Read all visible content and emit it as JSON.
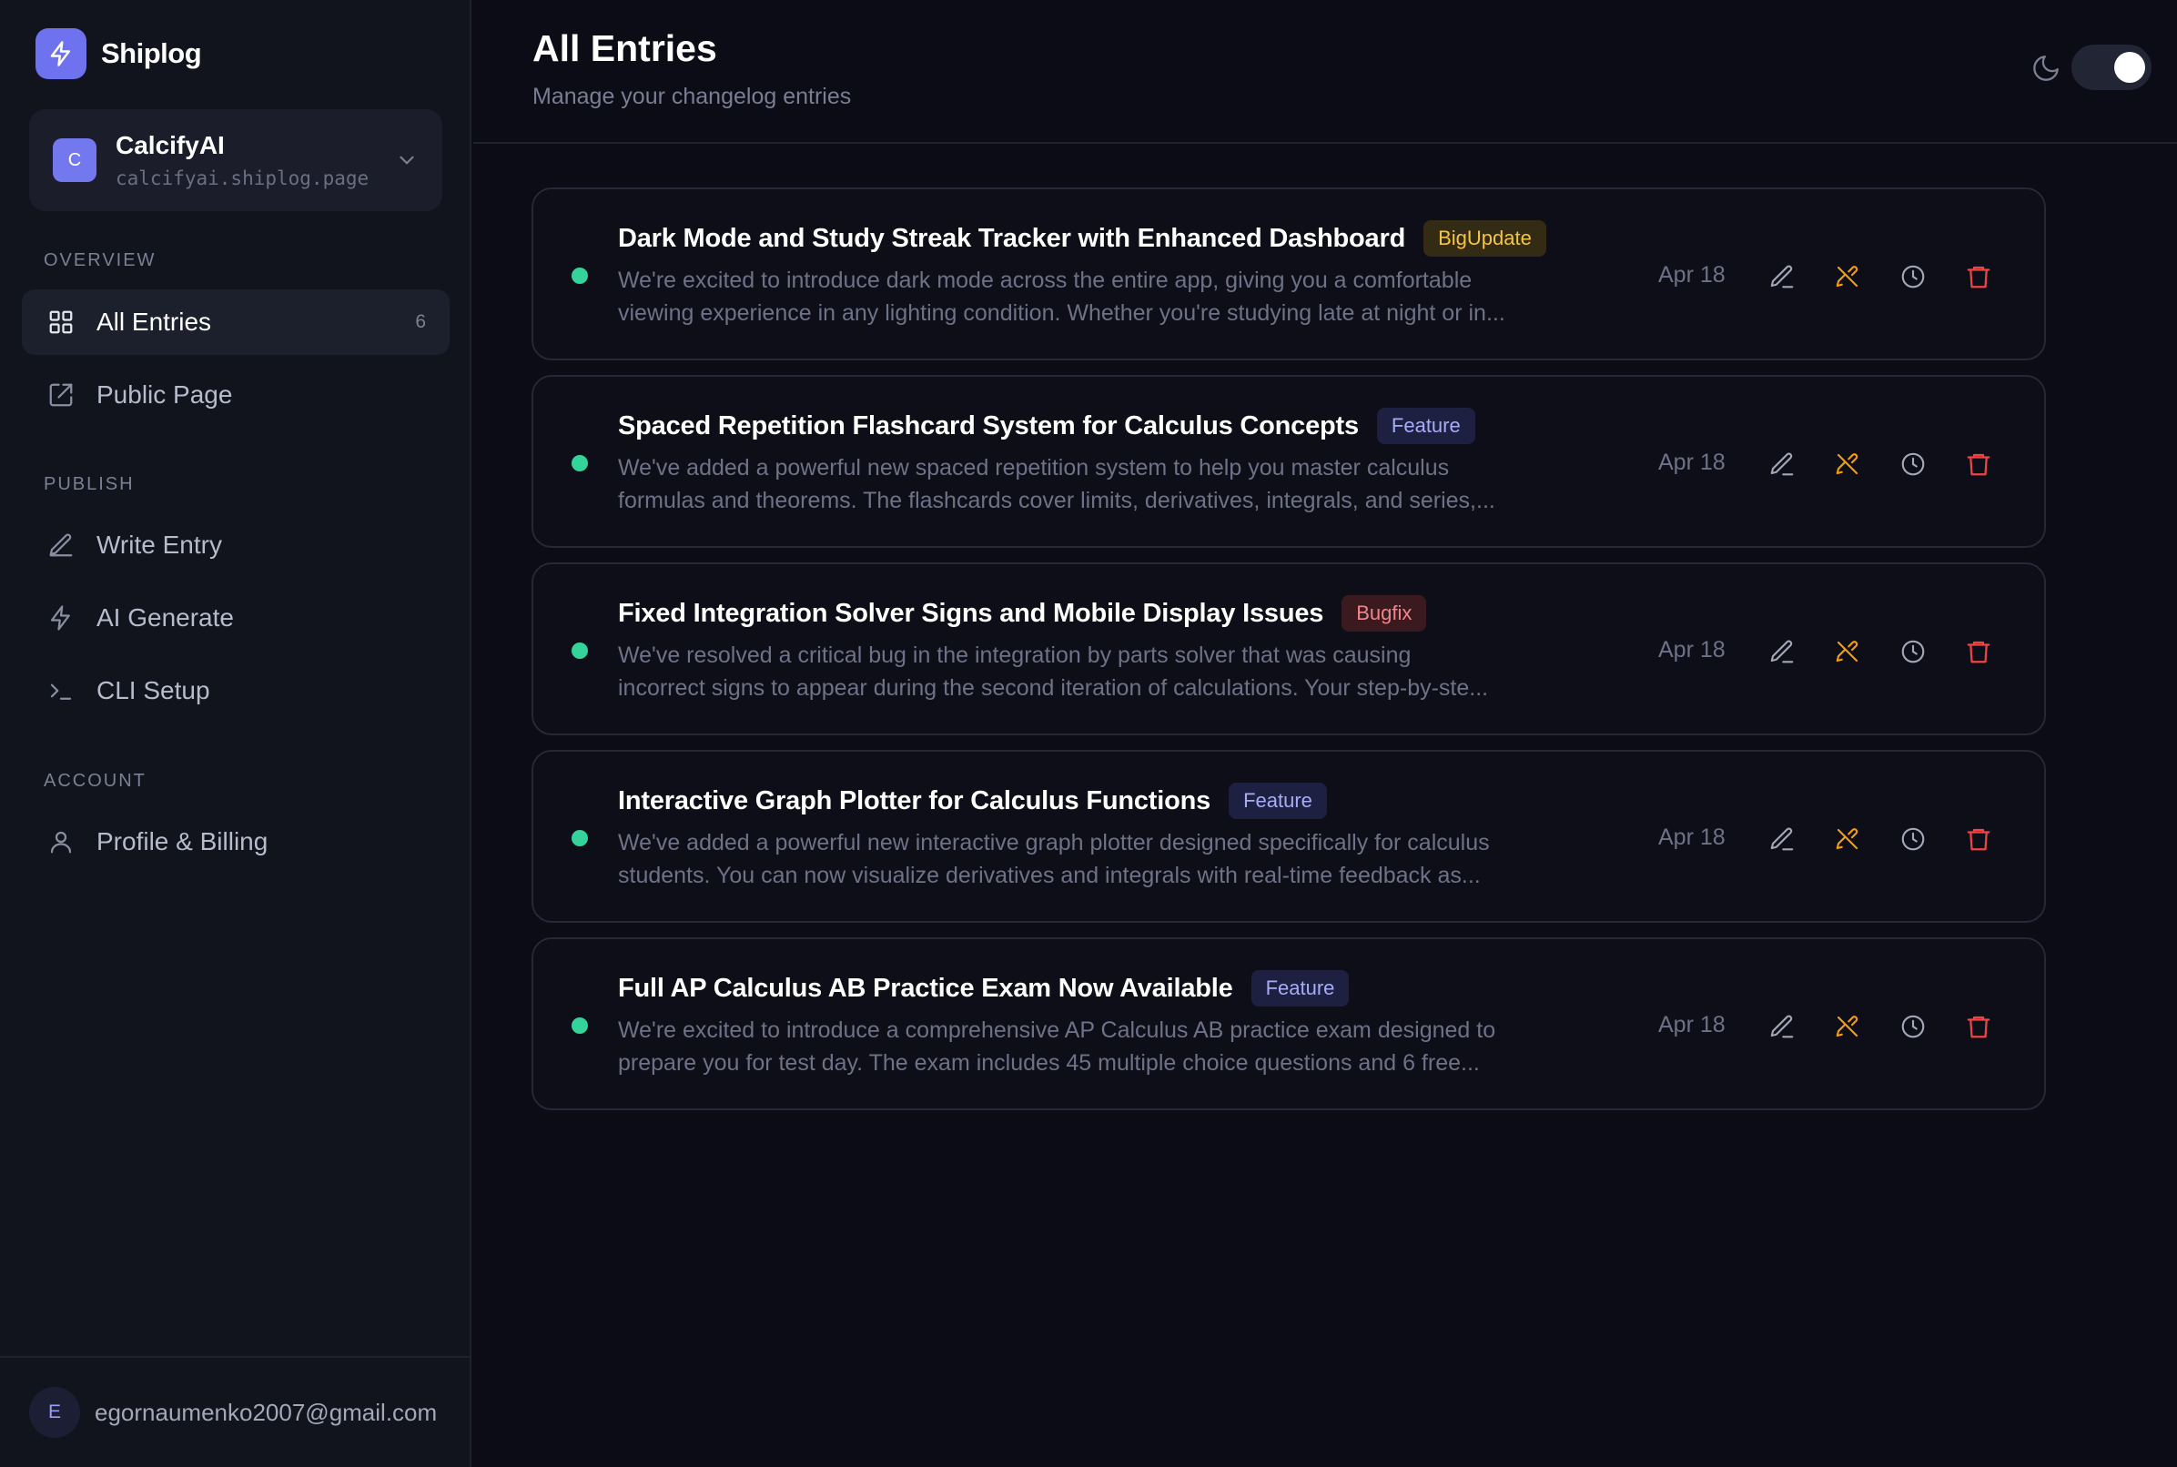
{
  "app": {
    "name": "Shiplog",
    "accent": "#6e72ee"
  },
  "project": {
    "initial": "C",
    "name": "CalcifyAI",
    "url": "calcifyai.shiplog.page"
  },
  "sidebar": {
    "sections": [
      {
        "label": "OVERVIEW",
        "items": [
          {
            "label": "All Entries",
            "icon": "grid-icon",
            "count": "6",
            "active": true
          },
          {
            "label": "Public Page",
            "icon": "external-link-icon",
            "count": "",
            "active": false
          }
        ]
      },
      {
        "label": "PUBLISH",
        "items": [
          {
            "label": "Write Entry",
            "icon": "pencil-icon",
            "count": "",
            "active": false
          },
          {
            "label": "AI Generate",
            "icon": "lightning-icon",
            "count": "",
            "active": false
          },
          {
            "label": "CLI Setup",
            "icon": "terminal-icon",
            "count": "",
            "active": false
          }
        ]
      },
      {
        "label": "ACCOUNT",
        "items": [
          {
            "label": "Profile & Billing",
            "icon": "user-icon",
            "count": "",
            "active": false
          }
        ]
      }
    ]
  },
  "user": {
    "initial": "E",
    "email": "egornaumenko2007@gmail.com"
  },
  "header": {
    "title": "All Entries",
    "subtitle": "Manage your changelog entries",
    "theme": "dark"
  },
  "entries": [
    {
      "title": "Dark Mode and Study Streak Tracker with Enhanced Dashboard",
      "badge": "BigUpdate",
      "badge_type": "bigupdate",
      "desc_line1": "We're excited to introduce dark mode across the entire app, giving you a comfortable",
      "desc_line2": "viewing experience in any lighting condition. Whether you're studying late at night or in...",
      "date": "Apr 18",
      "status": "published"
    },
    {
      "title": "Spaced Repetition Flashcard System for Calculus Concepts",
      "badge": "Feature",
      "badge_type": "feature",
      "desc_line1": "We've added a powerful new spaced repetition system to help you master calculus",
      "desc_line2": "formulas and theorems. The flashcards cover limits, derivatives, integrals, and series,...",
      "date": "Apr 18",
      "status": "published"
    },
    {
      "title": "Fixed Integration Solver Signs and Mobile Display Issues",
      "badge": "Bugfix",
      "badge_type": "bugfix",
      "desc_line1": "We've resolved a critical bug in the integration by parts solver that was causing",
      "desc_line2": "incorrect signs to appear during the second iteration of calculations. Your step-by-ste...",
      "date": "Apr 18",
      "status": "published"
    },
    {
      "title": "Interactive Graph Plotter for Calculus Functions",
      "badge": "Feature",
      "badge_type": "feature",
      "desc_line1": "We've added a powerful new interactive graph plotter designed specifically for calculus",
      "desc_line2": "students. You can now visualize derivatives and integrals with real-time feedback as...",
      "date": "Apr 18",
      "status": "published"
    },
    {
      "title": "Full AP Calculus AB Practice Exam Now Available",
      "badge": "Feature",
      "badge_type": "feature",
      "desc_line1": "We're excited to introduce a comprehensive AP Calculus AB practice exam designed to",
      "desc_line2": "prepare you for test day. The exam includes 45 multiple choice questions and 6 free...",
      "date": "Apr 18",
      "status": "published"
    }
  ],
  "entry_actions": [
    "edit-icon",
    "unpublish-icon",
    "history-icon",
    "delete-icon"
  ],
  "colors": {
    "published_dot": "#34d399",
    "unpublish": "#f59e0b",
    "delete": "#ef4444"
  }
}
